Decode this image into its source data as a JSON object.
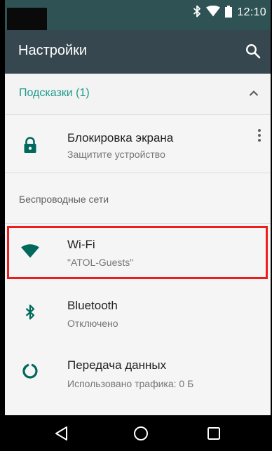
{
  "status_bar": {
    "time": "12:10",
    "icons": [
      "bluetooth-icon",
      "wifi-icon",
      "battery-icon"
    ]
  },
  "toolbar": {
    "title": "Настройки",
    "search_icon": "search-icon"
  },
  "suggestions": {
    "label": "Подсказки (1)",
    "expand_icon": "chevron-up-icon",
    "items": [
      {
        "title": "Блокировка экрана",
        "subtitle": "Защитите устройство",
        "icon": "lock-icon",
        "menu_icon": "more-vert-icon"
      }
    ]
  },
  "wireless_section": {
    "label": "Беспроводные сети",
    "items": [
      {
        "title": "Wi-Fi",
        "subtitle": "\"ATOL-Guests\"",
        "icon": "wifi-icon",
        "highlighted": true
      },
      {
        "title": "Bluetooth",
        "subtitle": "Отключено",
        "icon": "bluetooth-icon"
      },
      {
        "title": "Передача данных",
        "subtitle": "Использовано трафика: 0 Б",
        "icon": "data-usage-icon"
      }
    ]
  },
  "nav_bar": {
    "buttons": [
      "back-icon",
      "home-icon",
      "recents-icon"
    ]
  },
  "colors": {
    "status_bar": "#2f5255",
    "toolbar": "#37474f",
    "accent": "#1e9a8a",
    "highlight": "#ee1c1c",
    "background": "#f5f5f5"
  }
}
